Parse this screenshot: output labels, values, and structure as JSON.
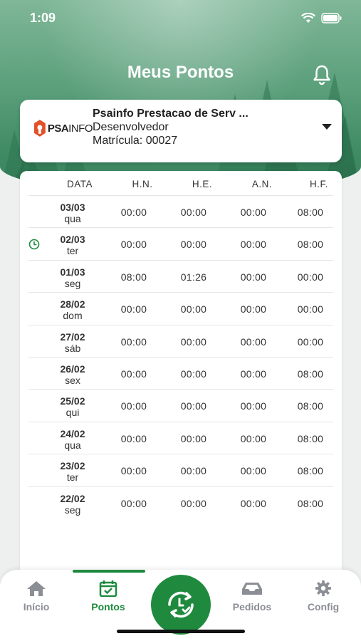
{
  "status_bar": {
    "time": "1:09"
  },
  "header": {
    "title": "Meus Pontos"
  },
  "company": {
    "logo_text_bold": "PSA",
    "logo_text_light": "INFO",
    "name": "Psainfo Prestacao de Serv ...",
    "role": "Desenvolvedor",
    "registration": "Matrícula: 00027"
  },
  "table": {
    "headers": {
      "date": "DATA",
      "hn": "H.N.",
      "he": "H.E.",
      "an": "A.N.",
      "hf": "H.F."
    },
    "rows": [
      {
        "date": "03/03",
        "weekday": "qua",
        "hn": "00:00",
        "he": "00:00",
        "an": "00:00",
        "hf": "08:00",
        "clock": false
      },
      {
        "date": "02/03",
        "weekday": "ter",
        "hn": "00:00",
        "he": "00:00",
        "an": "00:00",
        "hf": "08:00",
        "clock": true
      },
      {
        "date": "01/03",
        "weekday": "seg",
        "hn": "08:00",
        "he": "01:26",
        "an": "00:00",
        "hf": "00:00",
        "clock": false
      },
      {
        "date": "28/02",
        "weekday": "dom",
        "hn": "00:00",
        "he": "00:00",
        "an": "00:00",
        "hf": "00:00",
        "clock": false
      },
      {
        "date": "27/02",
        "weekday": "sáb",
        "hn": "00:00",
        "he": "00:00",
        "an": "00:00",
        "hf": "00:00",
        "clock": false
      },
      {
        "date": "26/02",
        "weekday": "sex",
        "hn": "00:00",
        "he": "00:00",
        "an": "00:00",
        "hf": "08:00",
        "clock": false
      },
      {
        "date": "25/02",
        "weekday": "qui",
        "hn": "00:00",
        "he": "00:00",
        "an": "00:00",
        "hf": "08:00",
        "clock": false
      },
      {
        "date": "24/02",
        "weekday": "qua",
        "hn": "00:00",
        "he": "00:00",
        "an": "00:00",
        "hf": "08:00",
        "clock": false
      },
      {
        "date": "23/02",
        "weekday": "ter",
        "hn": "00:00",
        "he": "00:00",
        "an": "00:00",
        "hf": "08:00",
        "clock": false
      },
      {
        "date": "22/02",
        "weekday": "seg",
        "hn": "00:00",
        "he": "00:00",
        "an": "00:00",
        "hf": "08:00",
        "clock": false
      }
    ]
  },
  "nav": {
    "items": [
      {
        "label": "Início",
        "icon": "home-icon"
      },
      {
        "label": "Pontos",
        "icon": "calendar-check-icon",
        "active": true
      },
      {
        "label": "Pedidos",
        "icon": "inbox-tray-icon"
      },
      {
        "label": "Config",
        "icon": "gear-icon"
      }
    ],
    "fab_icon": "clock-refresh-icon"
  },
  "colors": {
    "accent": "#1f8a3e",
    "inactive": "#8b8e95",
    "header_green": "#3f8a63"
  }
}
